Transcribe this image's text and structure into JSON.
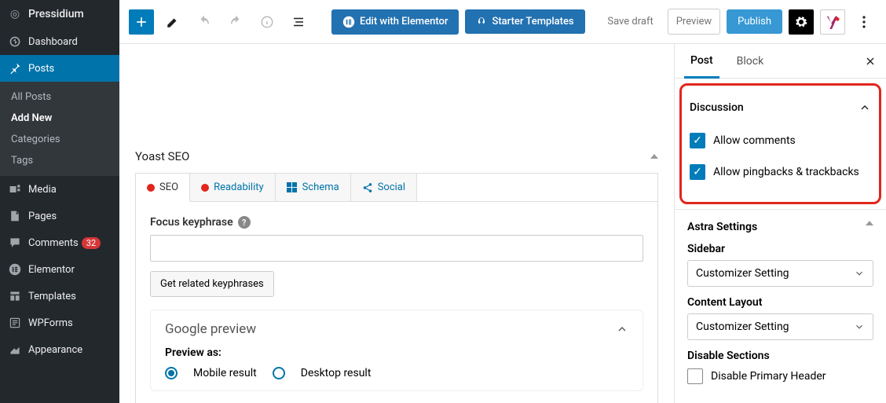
{
  "brand": "Pressidium",
  "nav": {
    "dashboard": "Dashboard",
    "posts": "Posts",
    "posts_sub": {
      "all": "All Posts",
      "add": "Add New",
      "categories": "Categories",
      "tags": "Tags"
    },
    "media": "Media",
    "pages": "Pages",
    "comments": "Comments",
    "comments_count": "32",
    "elementor": "Elementor",
    "templates": "Templates",
    "wpforms": "WPForms",
    "appearance": "Appearance"
  },
  "topbar": {
    "edit_elementor": "Edit with Elementor",
    "starter_templates": "Starter Templates",
    "save_draft": "Save draft",
    "preview": "Preview",
    "publish": "Publish"
  },
  "yoast": {
    "title": "Yoast SEO",
    "tabs": {
      "seo": "SEO",
      "readability": "Readability",
      "schema": "Schema",
      "social": "Social"
    },
    "focus_label": "Focus keyphrase",
    "get_related": "Get related keyphrases",
    "google_preview": "Google preview",
    "preview_as": "Preview as:",
    "mobile": "Mobile result",
    "desktop": "Desktop result"
  },
  "inspector": {
    "tab_post": "Post",
    "tab_block": "Block",
    "discussion": {
      "title": "Discussion",
      "allow_comments": "Allow comments",
      "allow_pingbacks": "Allow pingbacks & trackbacks"
    },
    "astra": {
      "title": "Astra Settings",
      "sidebar_label": "Sidebar",
      "sidebar_value": "Customizer Setting",
      "layout_label": "Content Layout",
      "layout_value": "Customizer Setting",
      "disable_sections": "Disable Sections",
      "disable_primary_header": "Disable Primary Header"
    }
  }
}
